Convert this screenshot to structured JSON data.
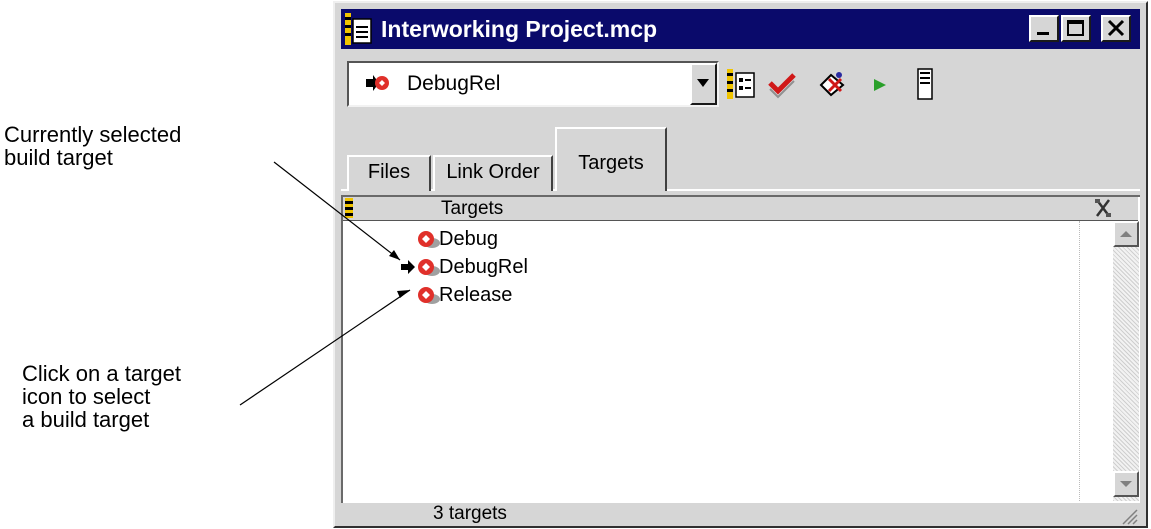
{
  "callouts": {
    "selected": {
      "line1": "Currently selected",
      "line2": "build target"
    },
    "click": {
      "line1": "Click on a target",
      "line2": "icon to select",
      "line3": "a build target"
    }
  },
  "window": {
    "title": "Interworking Project.mcp",
    "controls": [
      "minimize",
      "maximize",
      "close"
    ],
    "icon": "project-file-icon"
  },
  "toolbar": {
    "current_target": "DebugRel",
    "current_target_icon": "target-bullet-icon",
    "tools": [
      "target-settings-icon",
      "synchronize-icon",
      "make-icon",
      "run-icon",
      "project-inspector-icon"
    ]
  },
  "tabs": [
    {
      "label": "Files",
      "active": false
    },
    {
      "label": "Link Order",
      "active": false
    },
    {
      "label": "Targets",
      "active": true
    }
  ],
  "list": {
    "header": "Targets",
    "header_icons": [
      "column-marker-icon",
      "tools-icon"
    ],
    "items": [
      {
        "name": "Debug",
        "current": false
      },
      {
        "name": "DebugRel",
        "current": true
      },
      {
        "name": "Release",
        "current": false
      }
    ]
  },
  "status": {
    "text": "3 targets"
  },
  "colors": {
    "titlebar": "#0a0a6b",
    "window_face": "#d6d6d6",
    "target_icon": "#e0302a"
  }
}
